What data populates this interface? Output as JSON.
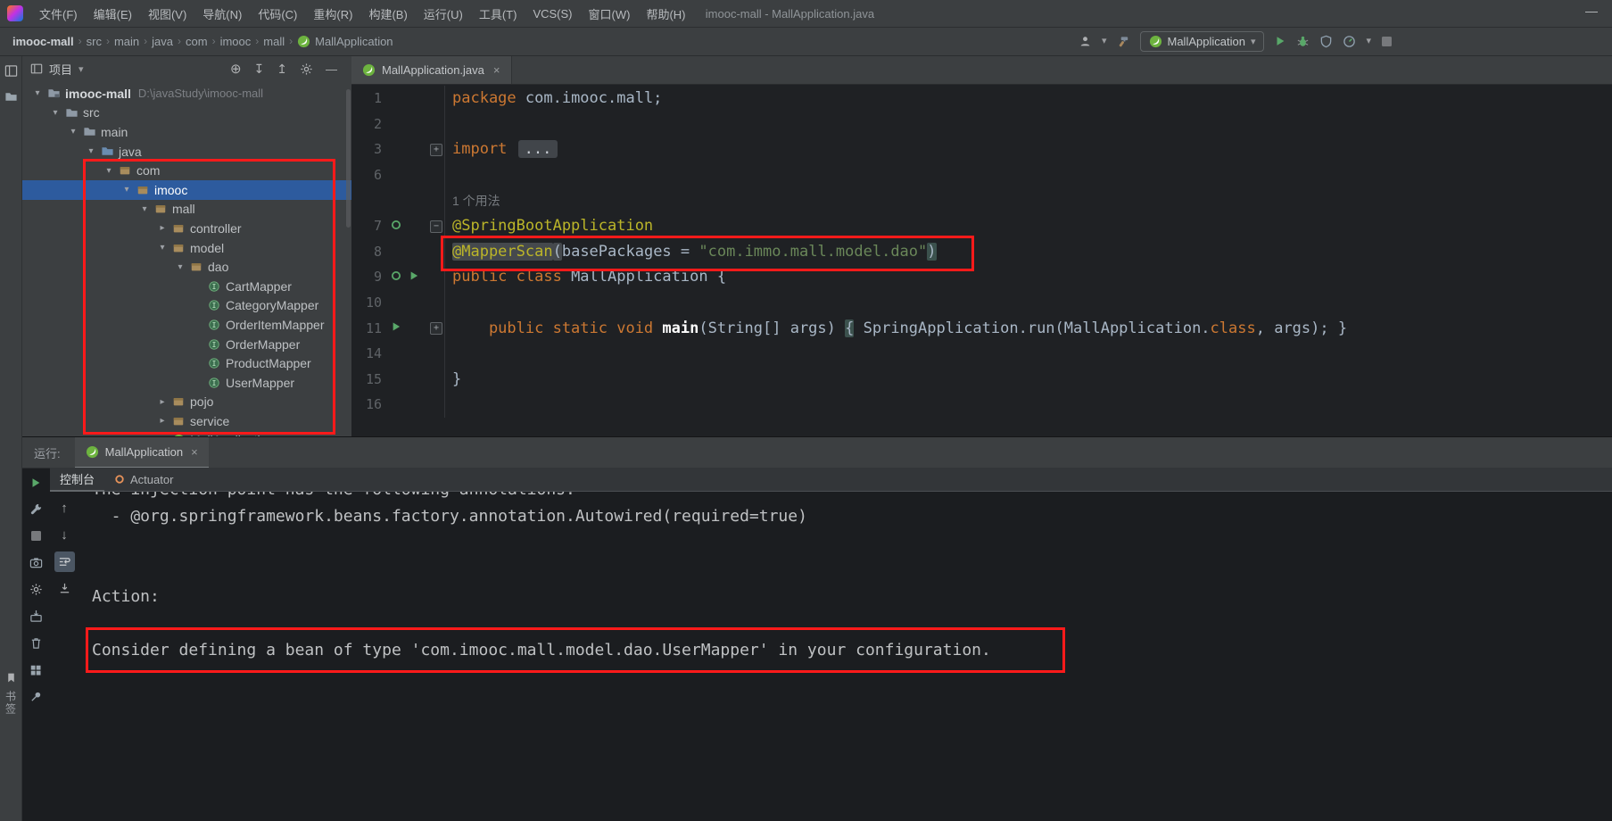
{
  "colors": {
    "annotation_red": "#ff1a1a",
    "selection_blue": "#2d5b9e",
    "spring_green": "#6db33f",
    "keyword_orange": "#cc7832",
    "string_green": "#6a8759",
    "annotation_yellow": "#bbb529",
    "chrome_gray": "#3c3f41",
    "editor_bg": "#1f2124"
  },
  "window": {
    "title": "imooc-mall - MallApplication.java",
    "minimize_label": "—"
  },
  "menu_bar": {
    "items": [
      "文件(F)",
      "编辑(E)",
      "视图(V)",
      "导航(N)",
      "代码(C)",
      "重构(R)",
      "构建(B)",
      "运行(U)",
      "工具(T)",
      "VCS(S)",
      "窗口(W)",
      "帮助(H)"
    ]
  },
  "nav_bar": {
    "separator": "›",
    "breadcrumbs": [
      "imooc-mall",
      "src",
      "main",
      "java",
      "com",
      "imooc",
      "mall"
    ],
    "leaf": {
      "icon": "spring-boot-icon",
      "label": "MallApplication"
    },
    "right": {
      "icons_before": [
        "user-icon",
        "caret-down-icon",
        "build-hammer-icon"
      ],
      "run_config": {
        "icon": "spring-boot-icon",
        "label": "MallApplication",
        "caret": "▾"
      },
      "icons_after": [
        "run-icon",
        "debug-icon",
        "coverage-icon",
        "profiler-icon",
        "caret-down-icon",
        "stop-icon"
      ]
    }
  },
  "left_strip": {
    "top_icons": [
      "project-tool-icon",
      "folder-tool-icon"
    ],
    "bottom": {
      "icons": [
        "bookmark-icon"
      ],
      "label": "书签"
    }
  },
  "project_panel": {
    "header": {
      "icon": "project-panel-icon",
      "title": "项目",
      "caret": "▾",
      "toolbar": [
        "locate-icon",
        "expand-all-icon",
        "collapse-all-icon",
        "settings-gear-icon",
        "hide-icon"
      ]
    },
    "tree": [
      {
        "label": "imooc-mall",
        "suffix": "D:\\javaStudy\\imooc-mall",
        "level": 0,
        "state": "expanded",
        "icon": "project-folder-icon",
        "bold": true
      },
      {
        "label": "src",
        "level": 1,
        "state": "expanded",
        "icon": "folder-icon"
      },
      {
        "label": "main",
        "level": 2,
        "state": "expanded",
        "icon": "folder-icon"
      },
      {
        "label": "java",
        "level": 3,
        "state": "expanded",
        "icon": "source-folder-icon"
      },
      {
        "label": "com",
        "level": 4,
        "state": "expanded",
        "icon": "package-icon"
      },
      {
        "label": "imooc",
        "level": 5,
        "state": "expanded",
        "icon": "package-icon",
        "selected": true
      },
      {
        "label": "mall",
        "level": 6,
        "state": "expanded",
        "icon": "package-icon"
      },
      {
        "label": "controller",
        "level": 7,
        "state": "collapsed",
        "icon": "package-icon"
      },
      {
        "label": "model",
        "level": 7,
        "state": "expanded",
        "icon": "package-icon"
      },
      {
        "label": "dao",
        "level": 8,
        "state": "expanded",
        "icon": "package-icon"
      },
      {
        "label": "CartMapper",
        "level": 9,
        "state": "leaf",
        "icon": "interface-icon"
      },
      {
        "label": "CategoryMapper",
        "level": 9,
        "state": "leaf",
        "icon": "interface-icon"
      },
      {
        "label": "OrderItemMapper",
        "level": 9,
        "state": "leaf",
        "icon": "interface-icon"
      },
      {
        "label": "OrderMapper",
        "level": 9,
        "state": "leaf",
        "icon": "interface-icon"
      },
      {
        "label": "ProductMapper",
        "level": 9,
        "state": "leaf",
        "icon": "interface-icon"
      },
      {
        "label": "UserMapper",
        "level": 9,
        "state": "leaf",
        "icon": "interface-icon"
      },
      {
        "label": "pojo",
        "level": 7,
        "state": "collapsed",
        "icon": "package-icon"
      },
      {
        "label": "service",
        "level": 7,
        "state": "collapsed",
        "icon": "package-icon"
      },
      {
        "label": "MallApplication",
        "level": 7,
        "state": "leaf",
        "icon": "spring-boot-icon"
      }
    ]
  },
  "editor": {
    "tab": {
      "icon": "spring-boot-icon",
      "title": "MallApplication.java",
      "close": "×"
    },
    "lines": [
      {
        "num": "1",
        "tokens": [
          [
            "kw",
            "package "
          ],
          [
            "pl",
            "com.imooc.mall;"
          ]
        ]
      },
      {
        "num": "2",
        "tokens": []
      },
      {
        "num": "3",
        "fold": "plus",
        "tokens": [
          [
            "kw",
            "import "
          ],
          [
            "foldbox",
            "..."
          ]
        ]
      },
      {
        "num": "6",
        "tokens": []
      },
      {
        "inlay": "1 个用法"
      },
      {
        "num": "7",
        "gutter": [
          "bean-gutter-icon"
        ],
        "fold": "minus",
        "tokens": [
          [
            "ann",
            "@SpringBootApplication"
          ]
        ]
      },
      {
        "num": "8",
        "tokens": [
          [
            "ann hlid",
            "@MapperScan"
          ],
          [
            "pl hlid",
            "("
          ],
          [
            "pl",
            "basePackages "
          ],
          [
            "pl",
            "= "
          ],
          [
            "str",
            "\"com.immo.mall.model.dao\""
          ],
          [
            "pl hlbrace",
            ")"
          ]
        ]
      },
      {
        "num": "9",
        "gutter": [
          "bean-gutter-icon",
          "run-gutter-icon"
        ],
        "tokens": [
          [
            "kw",
            "public class "
          ],
          [
            "pl",
            "MallApplication {"
          ]
        ]
      },
      {
        "num": "10",
        "tokens": []
      },
      {
        "num": "11",
        "gutter": [
          "run-gutter-icon"
        ],
        "fold": "plus",
        "tokens": [
          [
            "kw",
            "    public static void "
          ],
          [
            "decl",
            "main"
          ],
          [
            "pl",
            "(String[] args) "
          ],
          [
            "pl hlbrace",
            "{"
          ],
          [
            "pl",
            " SpringApplication.run(MallApplication."
          ],
          [
            "kw",
            "class"
          ],
          [
            "pl",
            ", args); }"
          ]
        ]
      },
      {
        "num": "14",
        "tokens": []
      },
      {
        "num": "15",
        "tokens": [
          [
            "pl",
            "}"
          ]
        ]
      },
      {
        "num": "16",
        "tokens": []
      }
    ]
  },
  "run_panel": {
    "label": "运行:",
    "tab": {
      "icon": "spring-boot-icon",
      "label": "MallApplication",
      "close": "×"
    },
    "main_toolbar": [
      "rerun-icon",
      "wrench-icon",
      "stop-icon",
      "screenshot-icon",
      "settings-gear-icon",
      "import-layout-icon",
      "clear-icon",
      "layout-icon",
      "pin-icon"
    ],
    "tabs": [
      {
        "label": "控制台",
        "selected": true
      },
      {
        "icon": "actuator-icon",
        "label": "Actuator"
      }
    ],
    "console_toolbar": [
      {
        "icon": "up-arrow-icon"
      },
      {
        "icon": "down-arrow-icon"
      },
      {
        "icon": "soft-wrap-icon",
        "selected": true
      },
      {
        "icon": "scroll-end-icon"
      }
    ],
    "console_lines": [
      "The injection point has the following annotations:",
      "  - @org.springframework.beans.factory.annotation.Autowired(required=true)",
      "",
      "",
      "Action:",
      "",
      "Consider defining a bean of type 'com.imooc.mall.model.dao.UserMapper' in your configuration."
    ]
  }
}
